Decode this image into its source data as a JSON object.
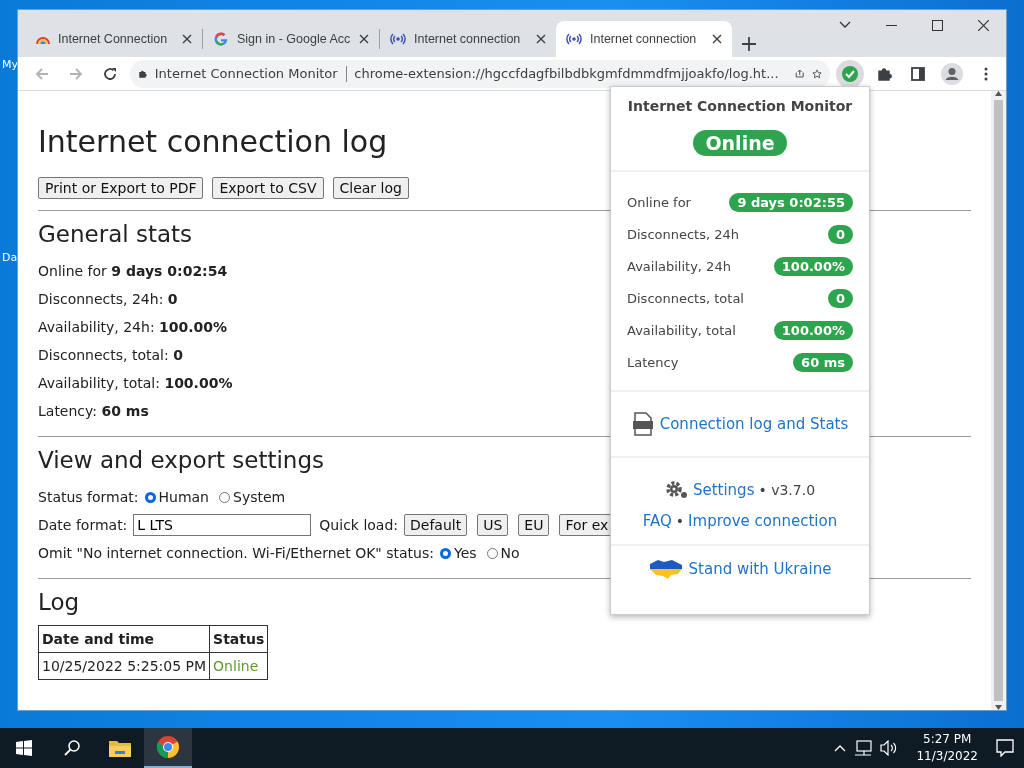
{
  "desktop": {
    "icon_labels": [
      "My",
      "Da"
    ]
  },
  "browser": {
    "tabs": [
      {
        "title": "Internet Connection",
        "kind": "rainbow",
        "selected": false
      },
      {
        "title": "Sign in - Google Acc",
        "kind": "google",
        "selected": false
      },
      {
        "title": "Internet connection",
        "kind": "radio",
        "selected": false
      },
      {
        "title": "Internet connection",
        "kind": "radio",
        "selected": true
      }
    ],
    "address": {
      "site_label": "Internet Connection Monitor",
      "url": "chrome-extension://hgccfdagfbilbdbkgmfdmmdfmjjoakfo/log.ht..."
    }
  },
  "page": {
    "title": "Internet connection log",
    "buttons": [
      "Print or Export to PDF",
      "Export to CSV",
      "Clear log"
    ],
    "general_stats": {
      "heading": "General stats",
      "rows": [
        "Online for **9 days 0:02:54**",
        "Disconnects, 24h: **0**",
        "Availability, 24h: **100.00%**",
        "Disconnects, total: **0**",
        "Availability, total: **100.00%**",
        "Latency: **60 ms**"
      ]
    },
    "settings": {
      "heading": "View and export settings",
      "status_format": {
        "label": "Status format:",
        "options": [
          {
            "label": "Human",
            "selected": true
          },
          {
            "label": "System",
            "selected": false
          }
        ]
      },
      "date_format": {
        "label": "Date format:",
        "value": "L LTS"
      },
      "quick_load": {
        "label": "Quick load:",
        "buttons": [
          "Default",
          "US",
          "EU",
          "For ex"
        ]
      },
      "omit": {
        "label": "Omit \"No internet connection. Wi-Fi/Ethernet OK\" status:",
        "options": [
          {
            "label": "Yes",
            "selected": true
          },
          {
            "label": "No",
            "selected": false
          }
        ]
      }
    },
    "log": {
      "heading": "Log",
      "columns": [
        "Date and time",
        "Status"
      ],
      "rows": [
        {
          "date": "10/25/2022 5:25:05 PM",
          "status": "Online"
        }
      ]
    }
  },
  "popup": {
    "title": "Internet Connection Monitor",
    "status": "Online",
    "stats": [
      {
        "label": "Online for",
        "value": "9 days 0:02:55"
      },
      {
        "label": "Disconnects, 24h",
        "value": "0"
      },
      {
        "label": "Availability, 24h",
        "value": "100.00%"
      },
      {
        "label": "Disconnects, total",
        "value": "0"
      },
      {
        "label": "Availability, total",
        "value": "100.00%"
      },
      {
        "label": "Latency",
        "value": "60 ms"
      }
    ],
    "log_link": "Connection log and Stats",
    "settings_link": "Settings",
    "version": "• v3.7.0",
    "faq_link": "FAQ",
    "separator": "•",
    "improve_link": "Improve connection",
    "ukraine_link": "Stand with Ukraine"
  },
  "taskbar": {
    "time": "5:27 PM",
    "date": "11/3/2022"
  }
}
